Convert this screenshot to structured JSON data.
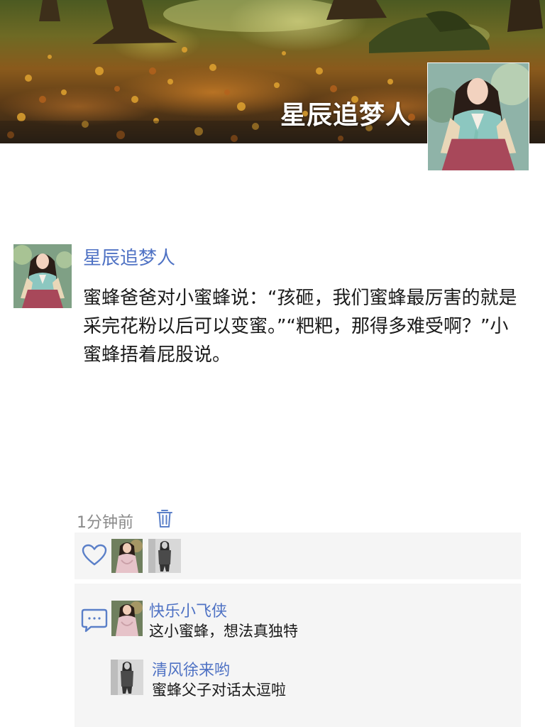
{
  "cover": {
    "title": "星辰追梦人"
  },
  "post": {
    "author": "星辰追梦人",
    "text": "蜜蜂爸爸对小蜜蜂说：“孩砸，我们蜜蜂最厉害的就是采完花粉以后可以变蜜。”“粑粑，那得多难受啊？”小蜜蜂捂着屁股说。",
    "time": "1分钟前"
  },
  "icons": {
    "delete": "trash-icon",
    "like": "heart-icon",
    "comment": "comment-bubble-icon"
  },
  "comments": [
    {
      "name": "快乐小飞侠",
      "text": "这小蜜蜂，想法真独特"
    },
    {
      "name": "清风徐来哟",
      "text": "蜜蜂父子对话太逗啦"
    }
  ],
  "colors": {
    "link": "#4f72c4",
    "icon": "#5a7fc8",
    "panel": "#f5f5f5"
  }
}
